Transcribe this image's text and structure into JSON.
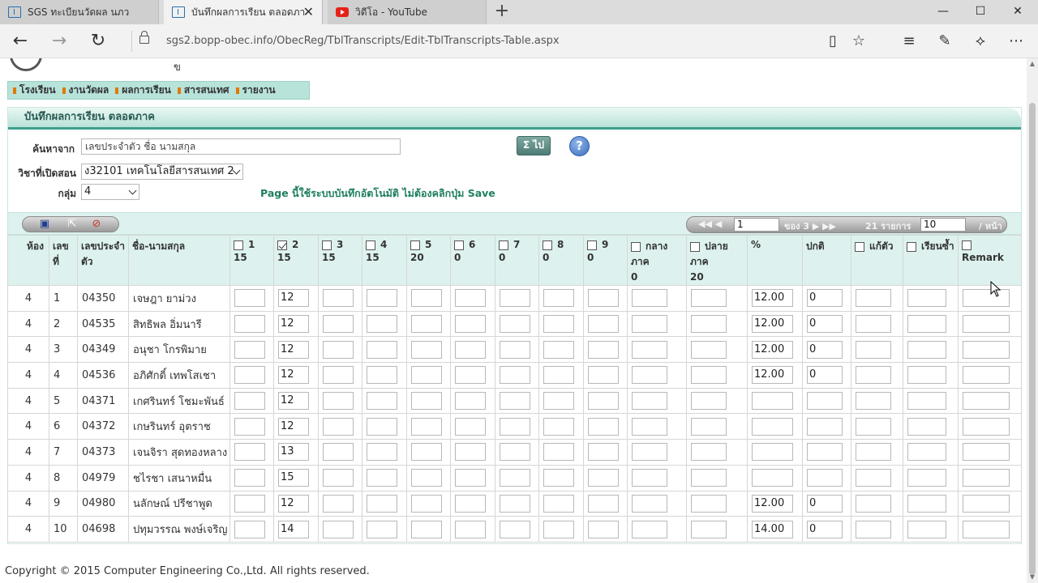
{
  "browser": {
    "tabs": [
      {
        "title": "SGS ทะเบียนวัดผล นภว",
        "icon": "window-icon"
      },
      {
        "title": "บันทึกผลการเรียน ตลอดภาค",
        "icon": "window-icon"
      },
      {
        "title": "วิดีโอ - YouTube",
        "icon": "youtube-icon"
      }
    ],
    "url": "sgs2.bopp-obec.info/ObecReg/TblTranscripts/Edit-TblTranscripts-Table.aspx"
  },
  "header": {
    "logo_char": "ข"
  },
  "menu": [
    "โรงเรียน",
    "งานวัดผล",
    "ผลการเรียน",
    "สารสนเทศ",
    "รายงาน"
  ],
  "panel": {
    "title": "บันทึกผลการเรียน ตลอดภาค"
  },
  "form": {
    "search_label": "ค้นหาจาก",
    "search_placeholder": "เลขประจำตัว ชื่อ นามสกุล",
    "subject_label": "วิชาที่เปิดสอน",
    "subject_value": "ง32101 เทคโนโลยีสารสนเทศ 2",
    "group_label": "กลุ่ม",
    "group_value": "4",
    "sum_button": "Σ ไป",
    "help": "?",
    "note": "Page นี้ใช้ระบบบันทึกอัตโนมัติ ไม่ต้องคลิกปุ่ม Save"
  },
  "pager": {
    "first_prev": "◀◀ ◀",
    "page": "1",
    "of": "ของ 3 ▶ ▶▶",
    "records": "21 รายการ",
    "per_page": "10",
    "per_label": "/ หน้า"
  },
  "columns": [
    {
      "label": "ห้อง"
    },
    {
      "label": "เลขที่"
    },
    {
      "label": "เลขประจำตัว"
    },
    {
      "label": "ชื่อ-นามสกุล"
    },
    {
      "label": "1",
      "max": "15",
      "checked": false
    },
    {
      "label": "2",
      "max": "15",
      "checked": true
    },
    {
      "label": "3",
      "max": "15",
      "checked": false
    },
    {
      "label": "4",
      "max": "15",
      "checked": false
    },
    {
      "label": "5",
      "max": "20",
      "checked": false
    },
    {
      "label": "6",
      "max": "0",
      "checked": false
    },
    {
      "label": "7",
      "max": "0",
      "checked": false
    },
    {
      "label": "8",
      "max": "0",
      "checked": false
    },
    {
      "label": "9",
      "max": "0",
      "checked": false
    },
    {
      "label": "กลางภาค",
      "max": "0",
      "checked": false
    },
    {
      "label": "ปลายภาค",
      "max": "20",
      "checked": false
    },
    {
      "label": "%"
    },
    {
      "label": "ปกติ"
    },
    {
      "label": "แก้ตัว",
      "checked": false
    },
    {
      "label": "เรียนซ้ำ",
      "checked": false
    },
    {
      "label": "Remark",
      "checked": false
    }
  ],
  "rows": [
    {
      "room": "4",
      "no": "1",
      "id": "04350",
      "name": "เจษฎา ยาม่วง",
      "s2": "12",
      "pct": "12.00",
      "normal": "0"
    },
    {
      "room": "4",
      "no": "2",
      "id": "04535",
      "name": "สิทธิพล อิ่มนารี",
      "s2": "12",
      "pct": "12.00",
      "normal": "0"
    },
    {
      "room": "4",
      "no": "3",
      "id": "04349",
      "name": "อนุชา โกรพิมาย",
      "s2": "12",
      "pct": "12.00",
      "normal": "0"
    },
    {
      "room": "4",
      "no": "4",
      "id": "04536",
      "name": "อภิศักดิ์ เทพโสเชา",
      "s2": "12",
      "pct": "12.00",
      "normal": "0"
    },
    {
      "room": "4",
      "no": "5",
      "id": "04371",
      "name": "เกศรินทร์ โชมะพันธ์",
      "s2": "12",
      "pct": "",
      "normal": ""
    },
    {
      "room": "4",
      "no": "6",
      "id": "04372",
      "name": "เกษรินทร์ อุตราช",
      "s2": "12",
      "pct": "",
      "normal": ""
    },
    {
      "room": "4",
      "no": "7",
      "id": "04373",
      "name": "เจนจิรา สุดทองหลาง",
      "s2": "13",
      "pct": "",
      "normal": ""
    },
    {
      "room": "4",
      "no": "8",
      "id": "04979",
      "name": "ชไรชา เสนาหมื่น",
      "s2": "15",
      "pct": "",
      "normal": ""
    },
    {
      "room": "4",
      "no": "9",
      "id": "04980",
      "name": "นลักษณ์ ปรีชาพูด",
      "s2": "12",
      "pct": "12.00",
      "normal": "0"
    },
    {
      "room": "4",
      "no": "10",
      "id": "04698",
      "name": "ปทุมวรรณ พงษ์เจริญ",
      "s2": "14",
      "pct": "14.00",
      "normal": "0"
    }
  ],
  "footer": "Copyright © 2015 Computer Engineering Co.,Ltd. All rights reserved."
}
